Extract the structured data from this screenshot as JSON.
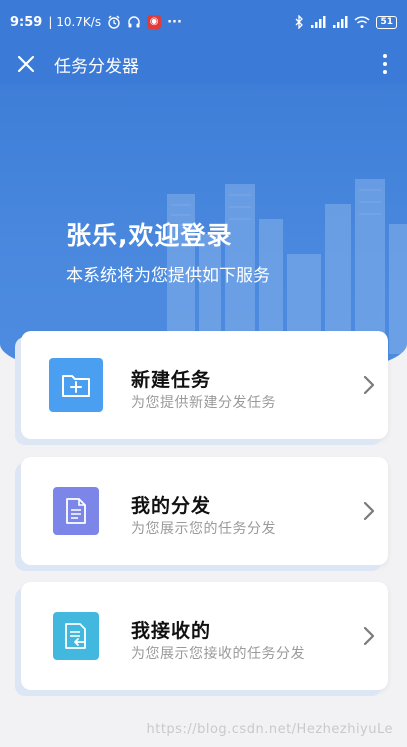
{
  "status_bar": {
    "time": "9:59",
    "speed": "| 10.7K/s",
    "battery": "51",
    "overflow": "···",
    "netease_badge": "◉"
  },
  "app_bar": {
    "title": "任务分发器"
  },
  "hero": {
    "title": "张乐,欢迎登录",
    "subtitle": "本系统将为您提供如下服务"
  },
  "cards": [
    {
      "title": "新建任务",
      "desc": "为您提供新建分发任务",
      "icon": "folder-plus-icon",
      "color": "#4a9ff0"
    },
    {
      "title": "我的分发",
      "desc": "为您展示您的任务分发",
      "icon": "document-icon",
      "color": "#7b86e8"
    },
    {
      "title": "我接收的",
      "desc": "为您展示您接收的任务分发",
      "icon": "receive-document-icon",
      "color": "#43b8df"
    }
  ],
  "watermark": "https://blog.csdn.net/HezhezhiyuLe"
}
